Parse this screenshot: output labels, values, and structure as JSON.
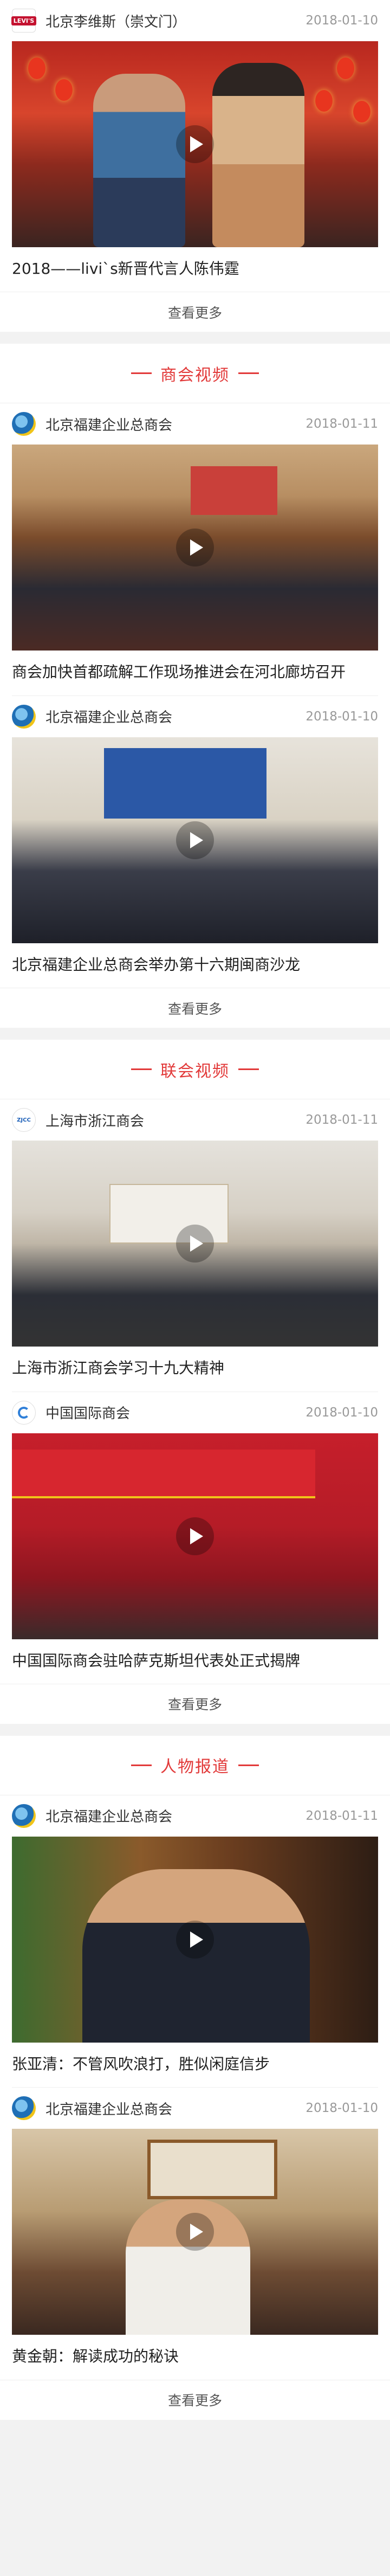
{
  "sections": {
    "top": {
      "card": {
        "org": "北京李维斯（崇文门）",
        "date": "2018-01-10",
        "title": "2018——livi`s新晋代言人陈伟霆",
        "logo_text": "LEVI'S"
      },
      "more_label": "查看更多"
    },
    "chamber": {
      "title": "商会视频",
      "cards": [
        {
          "org": "北京福建企业总商会",
          "date": "2018-01-11",
          "title": "商会加快首都疏解工作现场推进会在河北廊坊召开"
        },
        {
          "org": "北京福建企业总商会",
          "date": "2018-01-10",
          "title": "北京福建企业总商会举办第十六期闽商沙龙"
        }
      ],
      "more_label": "查看更多"
    },
    "union": {
      "title": "联会视频",
      "cards": [
        {
          "org": "上海市浙江商会",
          "date": "2018-01-11",
          "title": "上海市浙江商会学习十九大精神",
          "logo_text": "ZJCC"
        },
        {
          "org": "中国国际商会",
          "date": "2018-01-10",
          "title": "中国国际商会驻哈萨克斯坦代表处正式揭牌"
        }
      ],
      "more_label": "查看更多"
    },
    "people": {
      "title": "人物报道",
      "cards": [
        {
          "org": "北京福建企业总商会",
          "date": "2018-01-11",
          "title": "张亚清：不管风吹浪打，胜似闲庭信步"
        },
        {
          "org": "北京福建企业总商会",
          "date": "2018-01-10",
          "title": "黄金朝：解读成功的秘诀"
        }
      ],
      "more_label": "查看更多"
    }
  },
  "colors": {
    "accent": "#e23a3a",
    "background": "#f2f2f2"
  },
  "icons": {
    "play": "play-icon"
  }
}
